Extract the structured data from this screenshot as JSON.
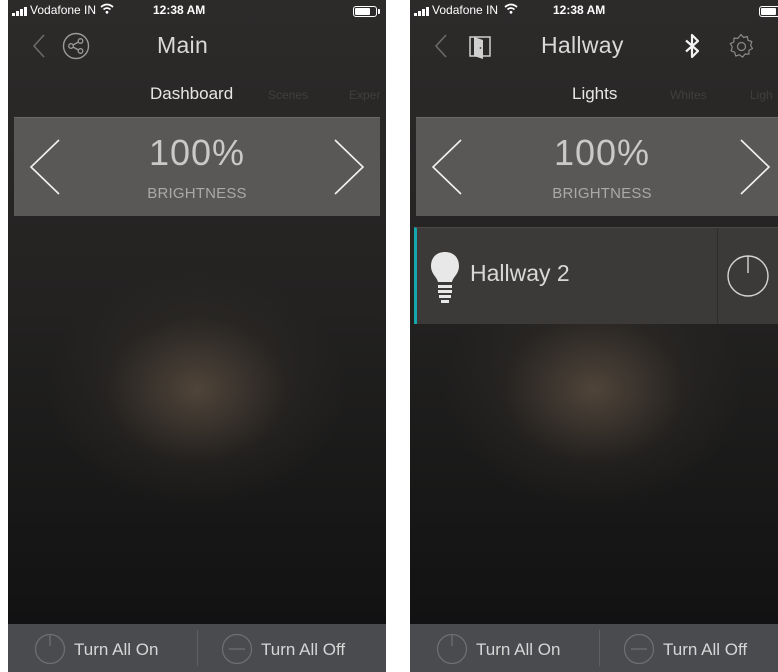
{
  "screens": [
    {
      "status": {
        "carrier": "Vodafone IN",
        "time": "12:38 AM"
      },
      "nav": {
        "title": "Main"
      },
      "tabs": [
        "Dashboard",
        "Scenes",
        "Exper"
      ],
      "brightness": {
        "value": "100%",
        "label": "BRIGHTNESS",
        "level": 1.0
      },
      "bottom": {
        "on_label": "Turn All On",
        "off_label": "Turn All Off"
      }
    },
    {
      "status": {
        "carrier": "Vodafone IN",
        "time": "12:38 AM"
      },
      "nav": {
        "title": "Hallway"
      },
      "tabs": [
        "Lights",
        "Whites",
        "Ligh"
      ],
      "brightness": {
        "value": "100%",
        "label": "BRIGHTNESS",
        "level": 1.0
      },
      "lights": [
        {
          "name": "Hallway 2",
          "power": "on"
        }
      ],
      "bottom": {
        "on_label": "Turn All On",
        "off_label": "Turn All Off"
      }
    }
  ],
  "colors": {
    "accent": "#16a6ae",
    "panel": "#5a5857",
    "bottom_bar": "#4a4b4e",
    "text": "#d9d9d9"
  },
  "icons": [
    "signal-icon",
    "wifi-icon",
    "battery-icon",
    "back-icon",
    "share-icon",
    "room-door-icon",
    "bluetooth-icon",
    "gear-icon",
    "chevron-left-icon",
    "chevron-right-icon",
    "bulb-icon",
    "power-icon",
    "minus-circle-icon"
  ]
}
